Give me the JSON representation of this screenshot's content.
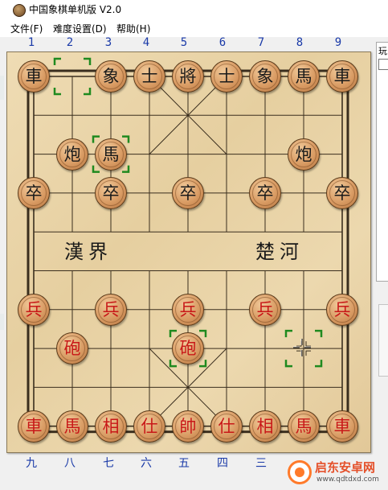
{
  "window": {
    "title": "中国象棋单机版 V2.0",
    "icon": "chess-piece-icon"
  },
  "menu": [
    {
      "label": "文件(F)"
    },
    {
      "label": "难度设置(D)"
    },
    {
      "label": "帮助(H)"
    }
  ],
  "columns_top": [
    "1",
    "2",
    "3",
    "4",
    "5",
    "6",
    "7",
    "8",
    "9"
  ],
  "columns_bottom": [
    "九",
    "八",
    "七",
    "六",
    "五",
    "四",
    "三"
  ],
  "river": {
    "left": "漢界",
    "right": "楚河"
  },
  "pieces": [
    {
      "text": "車",
      "side": "black",
      "file": 0,
      "rank": 0
    },
    {
      "text": "象",
      "side": "black",
      "file": 2,
      "rank": 0
    },
    {
      "text": "士",
      "side": "black",
      "file": 3,
      "rank": 0
    },
    {
      "text": "將",
      "side": "black",
      "file": 4,
      "rank": 0
    },
    {
      "text": "士",
      "side": "black",
      "file": 5,
      "rank": 0
    },
    {
      "text": "象",
      "side": "black",
      "file": 6,
      "rank": 0
    },
    {
      "text": "馬",
      "side": "black",
      "file": 7,
      "rank": 0
    },
    {
      "text": "車",
      "side": "black",
      "file": 8,
      "rank": 0
    },
    {
      "text": "炮",
      "side": "black",
      "file": 1,
      "rank": 2
    },
    {
      "text": "馬",
      "side": "black",
      "file": 2,
      "rank": 2
    },
    {
      "text": "炮",
      "side": "black",
      "file": 7,
      "rank": 2
    },
    {
      "text": "卒",
      "side": "black",
      "file": 0,
      "rank": 3
    },
    {
      "text": "卒",
      "side": "black",
      "file": 2,
      "rank": 3
    },
    {
      "text": "卒",
      "side": "black",
      "file": 4,
      "rank": 3
    },
    {
      "text": "卒",
      "side": "black",
      "file": 6,
      "rank": 3
    },
    {
      "text": "卒",
      "side": "black",
      "file": 8,
      "rank": 3
    },
    {
      "text": "兵",
      "side": "red",
      "file": 0,
      "rank": 6
    },
    {
      "text": "兵",
      "side": "red",
      "file": 2,
      "rank": 6
    },
    {
      "text": "兵",
      "side": "red",
      "file": 4,
      "rank": 6
    },
    {
      "text": "兵",
      "side": "red",
      "file": 6,
      "rank": 6
    },
    {
      "text": "兵",
      "side": "red",
      "file": 8,
      "rank": 6
    },
    {
      "text": "砲",
      "side": "red",
      "file": 1,
      "rank": 7
    },
    {
      "text": "砲",
      "side": "red",
      "file": 4,
      "rank": 7
    },
    {
      "text": "車",
      "side": "red",
      "file": 0,
      "rank": 9
    },
    {
      "text": "馬",
      "side": "red",
      "file": 1,
      "rank": 9
    },
    {
      "text": "相",
      "side": "red",
      "file": 2,
      "rank": 9
    },
    {
      "text": "仕",
      "side": "red",
      "file": 3,
      "rank": 9
    },
    {
      "text": "帥",
      "side": "red",
      "file": 4,
      "rank": 9
    },
    {
      "text": "仕",
      "side": "red",
      "file": 5,
      "rank": 9
    },
    {
      "text": "相",
      "side": "red",
      "file": 6,
      "rank": 9
    },
    {
      "text": "馬",
      "side": "red",
      "file": 7,
      "rank": 9
    },
    {
      "text": "車",
      "side": "red",
      "file": 8,
      "rank": 9
    }
  ],
  "selection_markers": [
    {
      "file": 1,
      "rank": 0
    },
    {
      "file": 2,
      "rank": 2
    },
    {
      "file": 4,
      "rank": 7
    },
    {
      "file": 7,
      "rank": 7
    }
  ],
  "right_panel": {
    "label": "玩"
  },
  "watermark": {
    "title": "启东安卓网",
    "url": "www.qdtdxd.com"
  },
  "colors": {
    "board": "#e8d2a6",
    "line": "#3a2e1e",
    "red_piece_text": "#c81818",
    "black_piece_text": "#1a1a1a",
    "marker": "#1f8a1f",
    "column_labels": "#1a3aa8"
  }
}
